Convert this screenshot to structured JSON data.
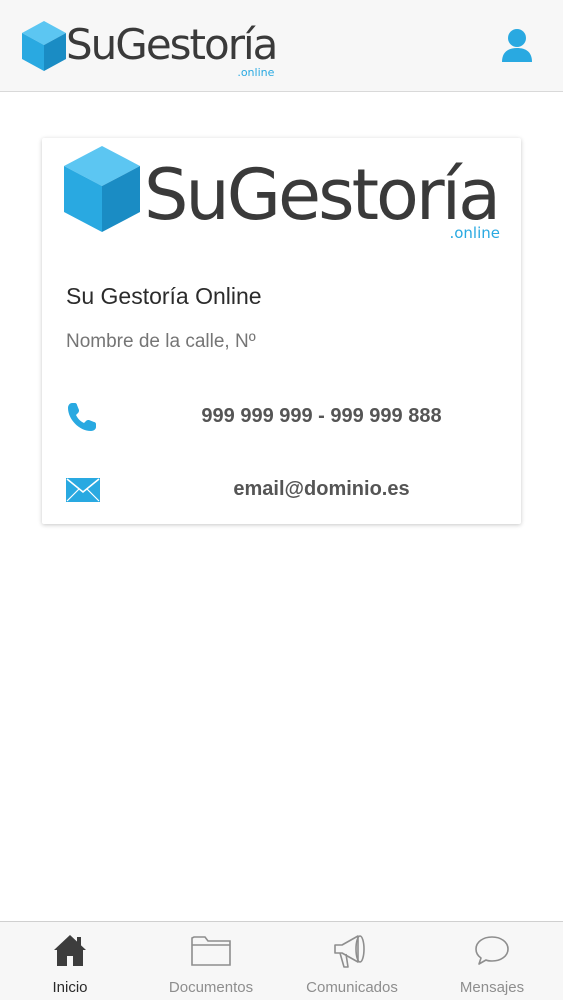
{
  "header": {
    "logo": {
      "word": "SuGestoría",
      "suffix": ".online"
    }
  },
  "card": {
    "logo": {
      "word": "SuGestoría",
      "suffix": ".online"
    },
    "company_name": "Su Gestoría Online",
    "address": "Nombre de la calle, Nº",
    "phone": "999 999 999 - 999 999 888",
    "email": "email@dominio.es"
  },
  "tabbar": {
    "tabs": [
      {
        "label": "Inicio",
        "icon": "home-icon",
        "active": true
      },
      {
        "label": "Documentos",
        "icon": "folder-icon",
        "active": false
      },
      {
        "label": "Comunicados",
        "icon": "megaphone-icon",
        "active": false
      },
      {
        "label": "Mensajes",
        "icon": "chat-bubble-icon",
        "active": false
      }
    ]
  },
  "colors": {
    "brand_blue": "#29a9e1",
    "brand_blue_light": "#5cc6f2",
    "brand_blue_dark": "#1a8cc4",
    "text_dark": "#3a3a3a",
    "tab_inactive": "#8e8e8e",
    "tab_active": "#2a2a2a"
  }
}
